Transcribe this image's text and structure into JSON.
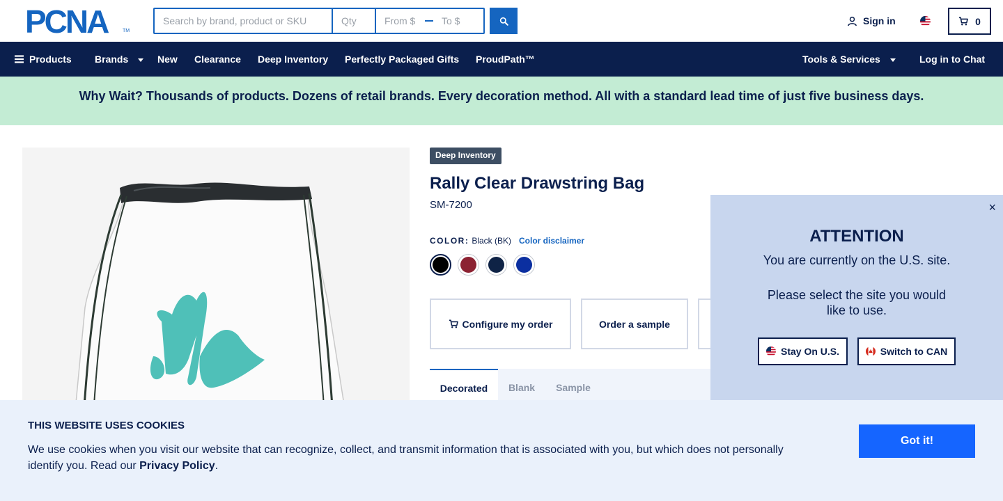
{
  "header": {
    "logo_text": "PCNA",
    "logo_tm": "TM",
    "search_placeholder": "Search by brand, product or SKU",
    "qty_placeholder": "Qty",
    "from_placeholder": "From $",
    "to_placeholder": "To $",
    "sign_in_label": "Sign in",
    "cart_count": "0"
  },
  "nav": {
    "products": "Products",
    "brands": "Brands",
    "new": "New",
    "clearance": "Clearance",
    "deep_inventory": "Deep Inventory",
    "packaged_gifts": "Perfectly Packaged Gifts",
    "proudpath": "ProudPath™",
    "tools_services": "Tools & Services",
    "login_chat": "Log in to Chat"
  },
  "banner": {
    "text": "Why Wait? Thousands of products. Dozens of retail brands. Every decoration method. All with a standard lead time of just five business days."
  },
  "product": {
    "badge": "Deep Inventory",
    "title": "Rally Clear Drawstring Bag",
    "sku": "SM-7200",
    "color_label": "COLOR:",
    "color_value": "Black (BK)",
    "color_disclaimer": "Color disclaimer",
    "swatches": [
      "#000000",
      "#8c2232",
      "#0f2346",
      "#0b2fa0"
    ],
    "configure_label": "Configure my order",
    "sample_label": "Order a sample",
    "tabs": [
      "Decorated",
      "Blank",
      "Sample"
    ]
  },
  "site_modal": {
    "heading": "ATTENTION",
    "line1": "You are currently on the U.S. site.",
    "line2": "Please select the site you would like to use.",
    "stay_label": "Stay On U.S.",
    "switch_label": "Switch to CAN",
    "close": "×"
  },
  "cookie": {
    "title": "THIS WEBSITE USES COOKIES",
    "text": "We use cookies when you visit our website that can recognize, collect, and transmit information that is associated with you, but which does not personally identify you. Read our ",
    "link": "Privacy Policy",
    "end": ".",
    "button": "Got it!"
  }
}
